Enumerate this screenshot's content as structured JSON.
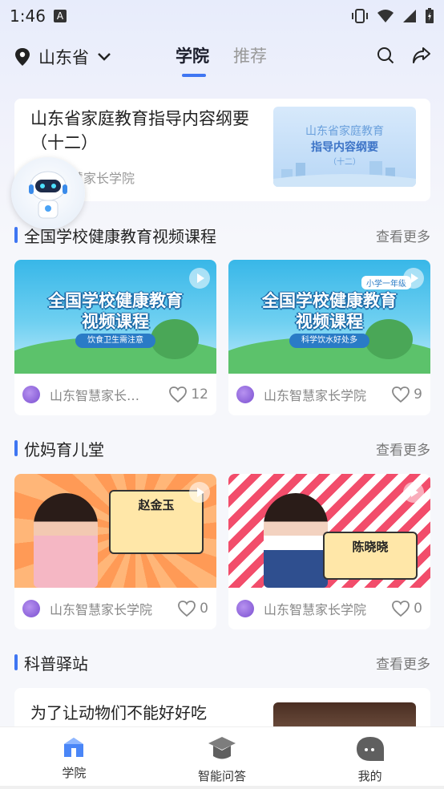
{
  "status_bar": {
    "time": "1:46",
    "notif_glyph": "A"
  },
  "header": {
    "location": "山东省",
    "tabs": [
      {
        "label": "学院",
        "active": true
      },
      {
        "label": "推荐",
        "active": false
      }
    ]
  },
  "featured": {
    "title": "山东省家庭教育指导内容纲要（十二）",
    "source": "慧家长学院",
    "thumb": {
      "line1": "山东省家庭教育",
      "line2": "指导内容纲要",
      "line3": "（十二）"
    }
  },
  "sections": [
    {
      "title": "全国学校健康教育视频课程",
      "more": "查看更多",
      "cards": [
        {
          "thumb_title_1": "全国学校健康教育",
          "thumb_title_2": "视频课程",
          "thumb_sub": "饮食卫生需注意",
          "tag": "",
          "source": "山东智慧家长…",
          "likes": "12"
        },
        {
          "thumb_title_1": "全国学校健康教育",
          "thumb_title_2": "视频课程",
          "thumb_sub": "科学饮水好处多",
          "tag": "小学一年级",
          "source": "山东智慧家长学院",
          "likes": "9"
        }
      ]
    },
    {
      "title": "优妈育儿堂",
      "more": "查看更多",
      "cards": [
        {
          "name": "赵金玉",
          "source": "山东智慧家长学院",
          "likes": "0"
        },
        {
          "name": "陈晓晓",
          "source": "山东智慧家长学院",
          "likes": "0"
        }
      ]
    },
    {
      "title": "科普驿站",
      "more": "查看更多"
    }
  ],
  "article": {
    "title": "为了让动物们不能好好吃"
  },
  "bottom_nav": [
    {
      "label": "学院",
      "active": true
    },
    {
      "label": "智能问答",
      "active": false
    },
    {
      "label": "我的",
      "active": false
    }
  ],
  "colors": {
    "accent": "#3f76f2",
    "active_nav": "#3f76f2"
  }
}
